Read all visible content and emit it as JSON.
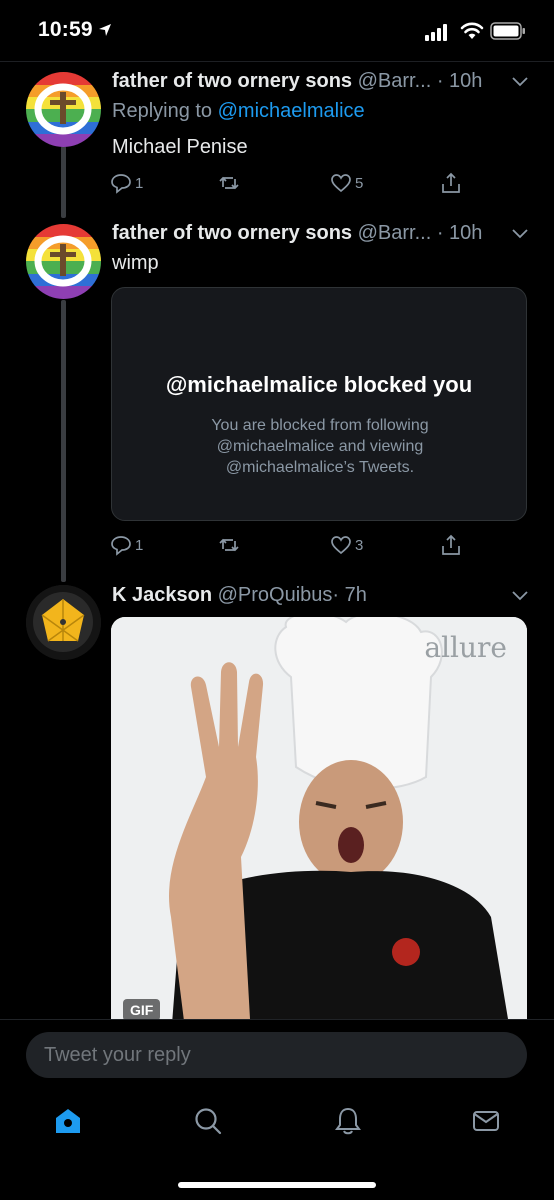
{
  "status_bar": {
    "time": "10:59",
    "icons": [
      "location-arrow-icon",
      "cellular-signal-icon",
      "wifi-icon",
      "battery-icon"
    ]
  },
  "tweets": [
    {
      "name": "father of two ornery sons",
      "handle": "@Barr...",
      "time": "· 10h",
      "replying_to_prefix": "Replying to",
      "replying_to": "@michaelmalice",
      "text": "Michael Penise",
      "reply_count": "1",
      "retweet_count": "",
      "like_count": "5"
    },
    {
      "name": "father of two ornery sons",
      "handle": "@Barr...",
      "time": "· 10h",
      "text": "wimp",
      "blocked_card": {
        "title": "@michaelmalice blocked you",
        "text": "You are blocked from following @michaelmalice and viewing @michaelmalice’s Tweets."
      },
      "reply_count": "1",
      "retweet_count": "",
      "like_count": "3"
    },
    {
      "name": "K Jackson",
      "handle": "@ProQuibus",
      "time": "· 7h",
      "media": {
        "watermark": "allure",
        "badge": "GIF"
      }
    }
  ],
  "reply_bar": {
    "placeholder": "Tweet your reply"
  },
  "tab_bar": {
    "tabs": [
      "home-icon",
      "search-icon",
      "notifications-icon",
      "messages-icon"
    ],
    "active": "home-icon"
  },
  "colors": {
    "background": "#000000",
    "accent": "#1d9bf0",
    "secondary_text": "#8b98a5",
    "card_background": "#16181c"
  }
}
